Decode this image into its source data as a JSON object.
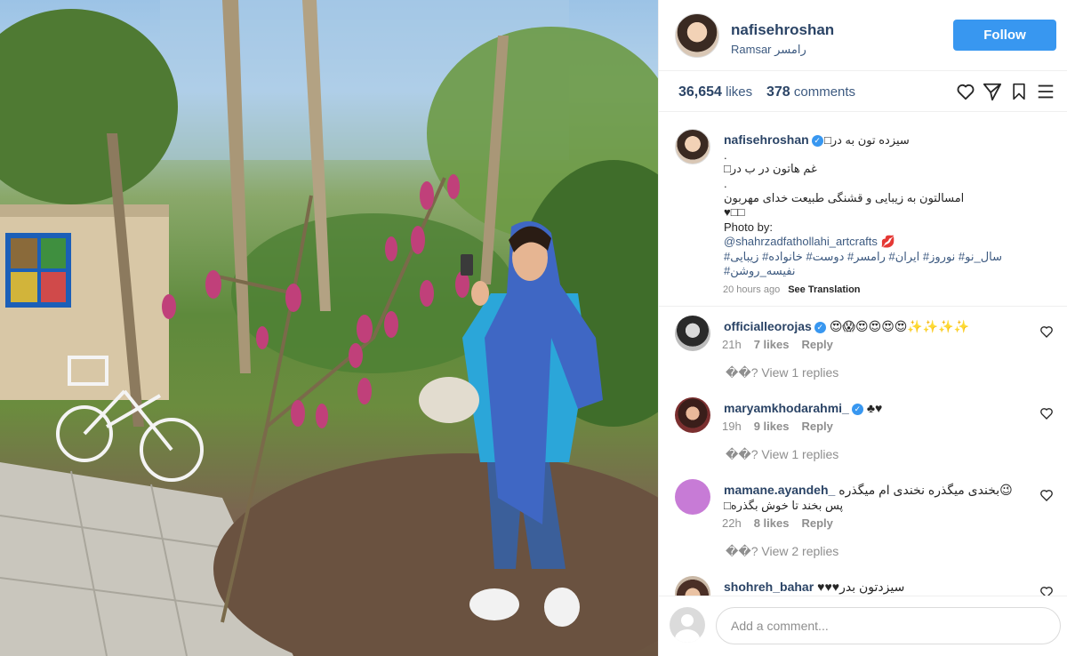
{
  "post": {
    "username": "nafisehroshan",
    "location": "Ramsar رامسر",
    "follow_label": "Follow",
    "likes_count": "36,654",
    "likes_label": "likes",
    "comments_count": "378",
    "comments_label": "comments"
  },
  "icons": {
    "like": "heart-icon",
    "share": "send-icon",
    "save": "bookmark-icon",
    "menu": "menu-icon"
  },
  "caption": {
    "username": "nafisehroshan",
    "lines": [
      "سیزده تون به در□",
      ".",
      "غم هاتون در ب در□",
      ".",
      "امسالتون به زیبایی و قشنگی طبیعت خدای مهربون",
      "♥□□",
      "Photo by:",
      "@shahrzadfathollahi_artcrafts 💋",
      "سال_نو# نوروز# ایران# رامسر# دوست# خانواده# زیبایی#",
      "نفیسه_روشن#"
    ],
    "time": "20 hours ago",
    "see_translation": "See Translation"
  },
  "comments": [
    {
      "username": "officialleorojas",
      "verified": true,
      "text": "😍😱😍😍😍😍✨✨✨✨",
      "time": "21h",
      "likes": "7 likes",
      "reply_label": "Reply",
      "replies": "��? View 1 replies"
    },
    {
      "username": "maryamkhodarahmi_",
      "verified": true,
      "text": "♣♥",
      "time": "19h",
      "likes": "9 likes",
      "reply_label": "Reply",
      "replies": "��? View 1 replies"
    },
    {
      "username": "mamane.ayandeh_",
      "verified": false,
      "text": "بخندی میگذره نخندی ام میگذره😉",
      "text2": "پس بخند تا خوش بگذره□",
      "time": "22h",
      "likes": "8 likes",
      "reply_label": "Reply",
      "replies": "��? View 2 replies"
    },
    {
      "username": "shohreh_bahar",
      "verified": false,
      "text": "♥♥♥سیزدتون بدر"
    }
  ],
  "add_comment": {
    "placeholder": "Add a comment..."
  },
  "colors": {
    "accent": "#3897f0",
    "username": "#2b4466",
    "muted": "#8e8e8e"
  }
}
